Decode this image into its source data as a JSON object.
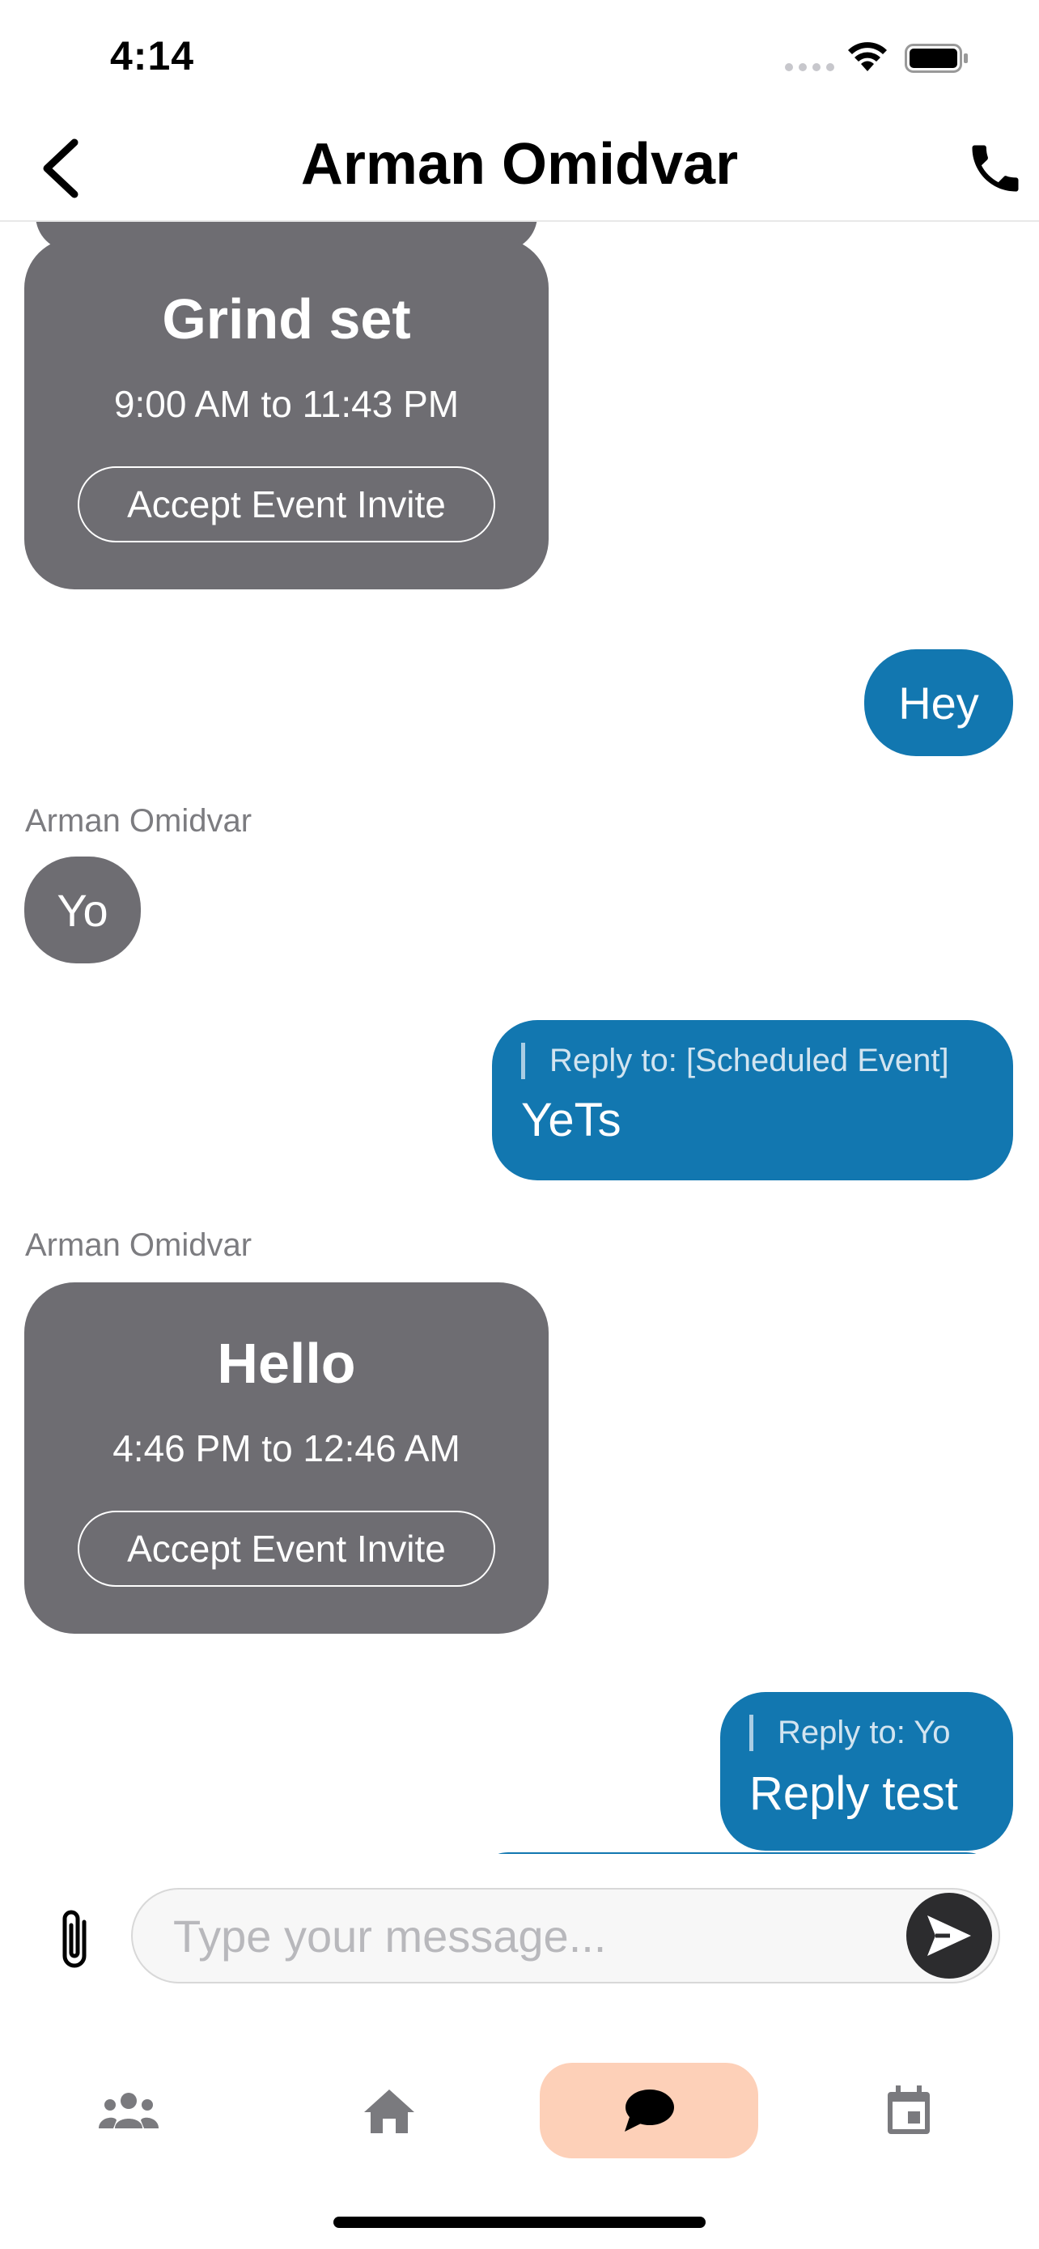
{
  "status_bar": {
    "time": "4:14"
  },
  "header": {
    "title": "Arman Omidvar"
  },
  "messages": {
    "event_1": {
      "title": "Grind set",
      "time": "9:00 AM to 11:43 PM",
      "accept_label": "Accept Event Invite"
    },
    "out_1": {
      "text": "Hey"
    },
    "sender_1": "Arman Omidvar",
    "in_1": {
      "text": "Yo"
    },
    "reply_1": {
      "quote": "Reply to: [Scheduled Event]",
      "text": "YeTs"
    },
    "sender_2": "Arman Omidvar",
    "event_2": {
      "title": "Hello",
      "time": "4:46 PM to 12:46 AM",
      "accept_label": "Accept Event Invite"
    },
    "reply_2": {
      "quote": "Reply to: Yo",
      "text": "Reply test"
    }
  },
  "composer": {
    "placeholder": "Type your message..."
  },
  "tab_bar": {
    "tabs": [
      {
        "icon": "people-icon"
      },
      {
        "icon": "home-icon"
      },
      {
        "icon": "chat-icon",
        "active": true
      },
      {
        "icon": "calendar-icon"
      }
    ]
  },
  "colors": {
    "outgoing_bubble": "#1277b0",
    "incoming_bubble": "#6e6d72",
    "active_tab": "#fdd0b8",
    "tab_icon": "#7a7a7e"
  }
}
